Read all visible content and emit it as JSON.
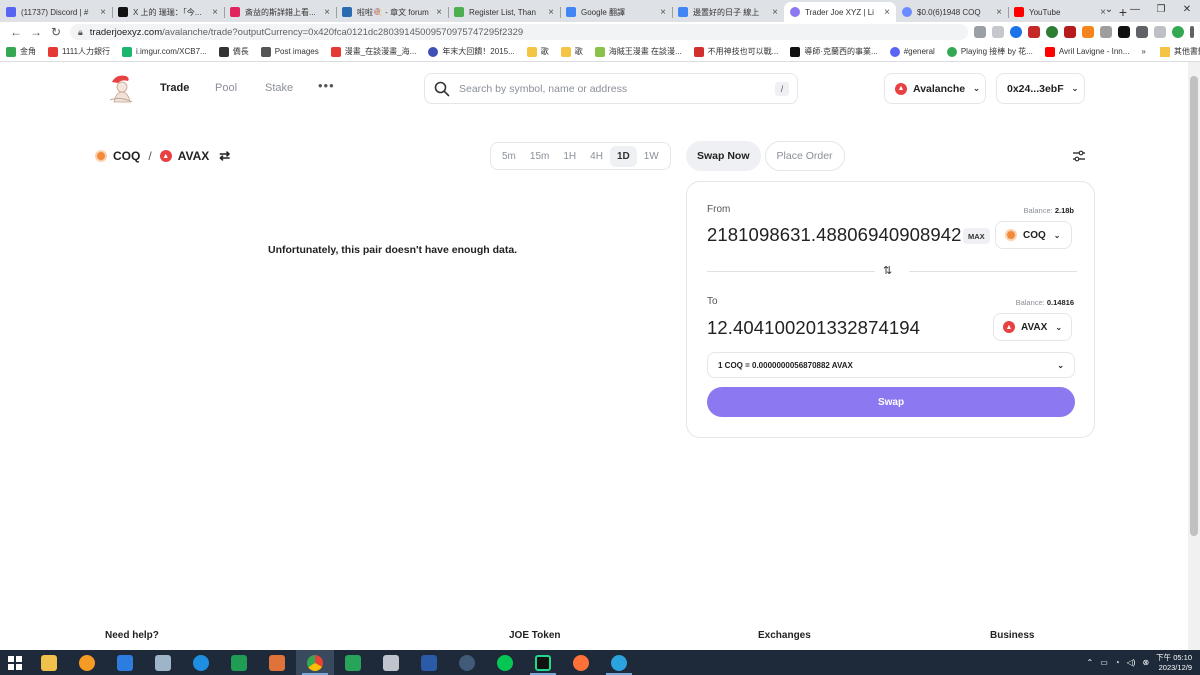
{
  "browser": {
    "tabs": [
      {
        "title": "(11737) Discord | #",
        "color": "#5865f2"
      },
      {
        "title": "X 上的 瑞瑞：「今...",
        "color": "#111111"
      },
      {
        "title": "斎益的斯詳錯上看...",
        "color": "#e0245e"
      },
      {
        "title": "啦啦🍭 - 章文 forum",
        "color": "#2b6cb0"
      },
      {
        "title": "Register List, Than",
        "color": "#4caf50"
      },
      {
        "title": "Google 翻譯",
        "color": "#4285f4"
      },
      {
        "title": "邊置好的日子 線上",
        "color": "#4285f4"
      },
      {
        "title": "Trader Joe XYZ | Li",
        "color": "#8c78f0"
      },
      {
        "title": "$0.0(6)1948 COQ",
        "color": "#6b8cff"
      },
      {
        "title": "YouTube",
        "color": "#ff0000"
      }
    ],
    "active_tab": 7,
    "url_host": "traderjoexyz.com",
    "url_path": "/avalanche/trade?outputCurrency=0x420fca0121dc28039145009570975747295f2329",
    "bookmarks": [
      {
        "label": "金角",
        "color": "#34a853"
      },
      {
        "label": "1111人力銀行",
        "color": "#e53935"
      },
      {
        "label": "i.imgur.com/XCB7...",
        "color": "#1bb76e"
      },
      {
        "label": "僑長",
        "color": "#333333"
      },
      {
        "label": "Post images",
        "color": "#555555"
      },
      {
        "label": "漫畫_在談漫畫_海...",
        "color": "#e53935"
      },
      {
        "label": "年末大回饋！2015...",
        "color": "#3f51b5"
      },
      {
        "label": "歌",
        "color": "#f4c542"
      },
      {
        "label": "歌",
        "color": "#f4c542"
      },
      {
        "label": "海賊王漫畫 在談漫...",
        "color": "#8bc34a"
      },
      {
        "label": "不用神技也可以戰...",
        "color": "#d32f2f"
      },
      {
        "label": "導師·克蘭西的事業...",
        "color": "#111111"
      },
      {
        "label": "#general",
        "color": "#5865f2"
      },
      {
        "label": "Playing 接棒 by 花...",
        "color": "#34a853"
      },
      {
        "label": "Avril Lavigne - Inn...",
        "color": "#ff0000"
      }
    ],
    "bookmarks_other": "其他書籤"
  },
  "nav": {
    "links": [
      "Trade",
      "Pool",
      "Stake"
    ],
    "more": "•••",
    "search_placeholder": "Search by symbol, name or address",
    "search_shortcut": "/",
    "network": "Avalanche",
    "wallet": "0x24...3ebF"
  },
  "pair": {
    "base": "COQ",
    "quote": "AVAX",
    "separator": "/"
  },
  "timeframes": [
    "5m",
    "15m",
    "1H",
    "4H",
    "1D",
    "1W"
  ],
  "active_timeframe": "1D",
  "chart_message": "Unfortunately, this pair doesn't have enough data.",
  "modes": {
    "swap_now": "Swap Now",
    "place_order": "Place Order"
  },
  "swap": {
    "from_label": "From",
    "from_balance_label": "Balance:",
    "from_balance": "2.18b",
    "from_amount": "2181098631.488069409089428",
    "max_label": "MAX",
    "from_token": "COQ",
    "to_label": "To",
    "to_balance_label": "Balance:",
    "to_balance": "0.14816",
    "to_amount": "12.404100201332874194",
    "to_token": "AVAX",
    "rate": "1 COQ = 0.0000000056870882 AVAX",
    "button": "Swap"
  },
  "footer": [
    "Need help?",
    "JOE Token",
    "Exchanges",
    "Business"
  ],
  "taskbar": {
    "icons": [
      {
        "name": "file-explorer-icon",
        "color": "#f0c14b"
      },
      {
        "name": "media-player-icon",
        "color": "#f59a23"
      },
      {
        "name": "network-app-icon",
        "color": "#2d7de0"
      },
      {
        "name": "calculator-icon",
        "color": "#9eb4c8"
      },
      {
        "name": "internet-explorer-icon",
        "color": "#1e8fe0"
      },
      {
        "name": "excel-icon",
        "color": "#1f9d55"
      },
      {
        "name": "paint-icon",
        "color": "#e0733a"
      },
      {
        "name": "chrome-icon",
        "color": "#e94235"
      },
      {
        "name": "kingsoft-icon",
        "color": "#27a35a"
      },
      {
        "name": "tool-icon",
        "color": "#c0c4cc"
      },
      {
        "name": "word-icon",
        "color": "#2b5aa8"
      },
      {
        "name": "steam-icon",
        "color": "#1b2838"
      },
      {
        "name": "line-icon",
        "color": "#06c755"
      },
      {
        "name": "pycharm-icon",
        "color": "#21d789"
      },
      {
        "name": "firefox-icon",
        "color": "#ff7139"
      },
      {
        "name": "telegram-icon",
        "color": "#2aa3df"
      }
    ],
    "clock_time": "下午 05:10",
    "clock_date": "2023/12/9"
  },
  "colors": {
    "accent": "#8c78f0",
    "avax": "#e84142",
    "coq": "#f28a3c"
  }
}
